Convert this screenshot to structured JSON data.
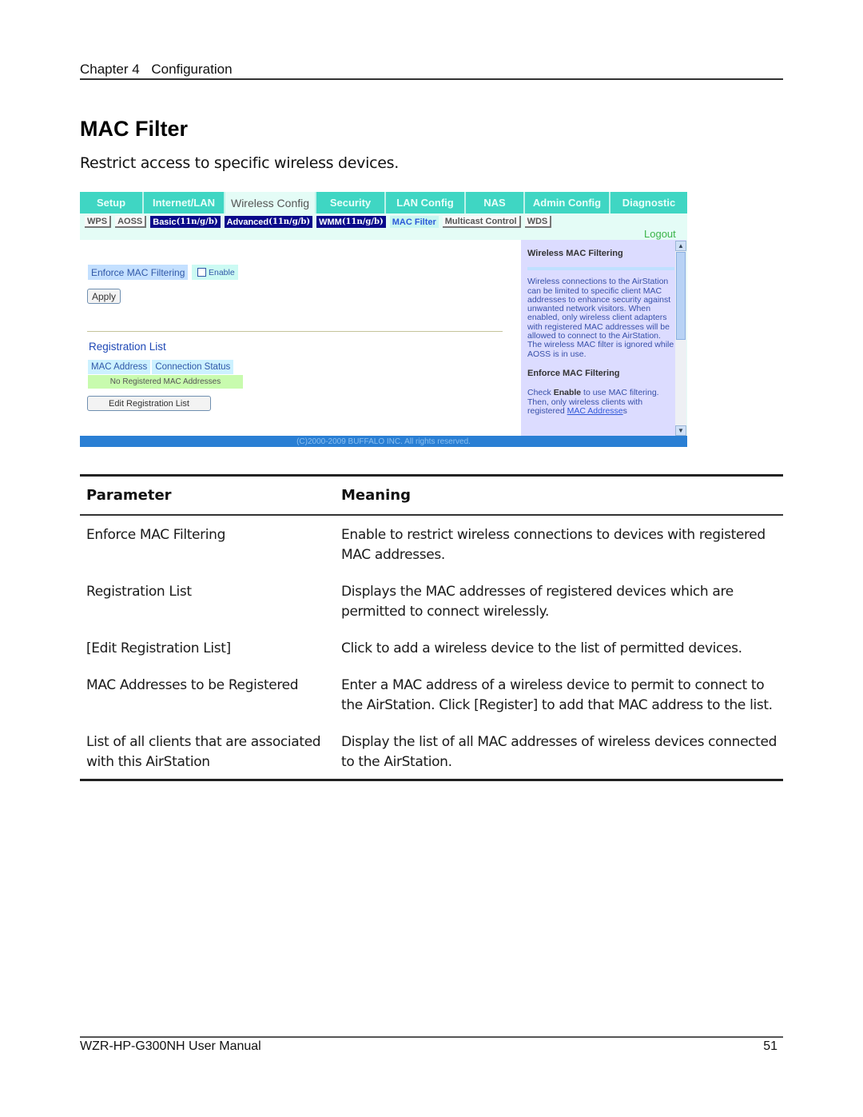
{
  "header": {
    "chapter_label": "Chapter 4",
    "chapter_title": "Configuration"
  },
  "title": "MAC Filter",
  "subtitle": "Restrict access to specific wireless devices.",
  "router_ui": {
    "nav_tabs": [
      {
        "label": "Setup",
        "active": false
      },
      {
        "label": "Internet/LAN",
        "active": false
      },
      {
        "label": "Wireless Config",
        "active": true
      },
      {
        "label": "Security",
        "active": false
      },
      {
        "label": "LAN Config",
        "active": false
      },
      {
        "label": "NAS",
        "active": false
      },
      {
        "label": "Admin Config",
        "active": false
      },
      {
        "label": "Diagnostic",
        "active": false
      }
    ],
    "sub_tabs": [
      {
        "label": "WPS",
        "suffix": ""
      },
      {
        "label": "AOSS",
        "suffix": ""
      },
      {
        "label": "Basic",
        "suffix": "(11n/g/b)"
      },
      {
        "label": "Advanced",
        "suffix": "(11n/g/b)"
      },
      {
        "label": "WMM",
        "suffix": "(11n/g/b)"
      },
      {
        "label": "MAC Filter",
        "suffix": ""
      },
      {
        "label": "Multicast Control",
        "suffix": ""
      },
      {
        "label": "WDS",
        "suffix": ""
      }
    ],
    "logout": "Logout",
    "enforce_label": "Enforce MAC Filtering",
    "enable_label": "Enable",
    "enable_checked": false,
    "apply_button": "Apply",
    "registration_title": "Registration List",
    "registration_columns": [
      "MAC Address",
      "Connection Status"
    ],
    "registration_empty": "No Registered MAC Addresses",
    "edit_button": "Edit Registration List",
    "help": {
      "heading1": "Wireless MAC Filtering",
      "paragraph1": "Wireless connections to the AirStation can be limited to specific client MAC addresses to enhance security against unwanted network visitors. When enabled, only wireless client adapters with registered MAC addresses will be allowed to connect to the AirStation. The wireless MAC filter is ignored while AOSS is in use.",
      "heading2": "Enforce MAC Filtering",
      "p2_pre": "Check ",
      "p2_bold": "Enable",
      "p2_mid": " to use MAC filtering. Then, only wireless clients with registered ",
      "p2_link": "MAC Addresse",
      "p2_post": "s"
    },
    "copyright": "(C)2000-2009 BUFFALO INC. All rights reserved.",
    "colors": {
      "nav_bg": "#3fd6c3",
      "page_bg": "#e4fcf6",
      "subtab_dark": "#0a0a8a",
      "help_bg": "#dcdcff",
      "footer_bar": "#2a7fd4",
      "logout": "#3bb44a"
    }
  },
  "table": {
    "headers": [
      "Parameter",
      "Meaning"
    ],
    "rows": [
      {
        "parameter": "Enforce MAC Filtering",
        "meaning": "Enable to restrict wireless connections to devices with registered MAC addresses."
      },
      {
        "parameter": "Registration List",
        "meaning": "Displays the MAC addresses of registered devices which are permitted to connect wirelessly."
      },
      {
        "parameter": "[Edit Registration List]",
        "meaning": "Click to add a wireless device to the list of permitted devices."
      },
      {
        "parameter": "MAC Addresses to be Registered",
        "meaning": "Enter a MAC address of a wireless device to permit to connect to the AirStation. Click [Register] to add that MAC address to the list."
      },
      {
        "parameter": "List of all clients that are associated with this AirStation",
        "meaning": "Display the list of all MAC addresses of wireless devices connected to the AirStation."
      }
    ]
  },
  "footer": {
    "manual": "WZR-HP-G300NH User Manual",
    "page_number": "51"
  }
}
